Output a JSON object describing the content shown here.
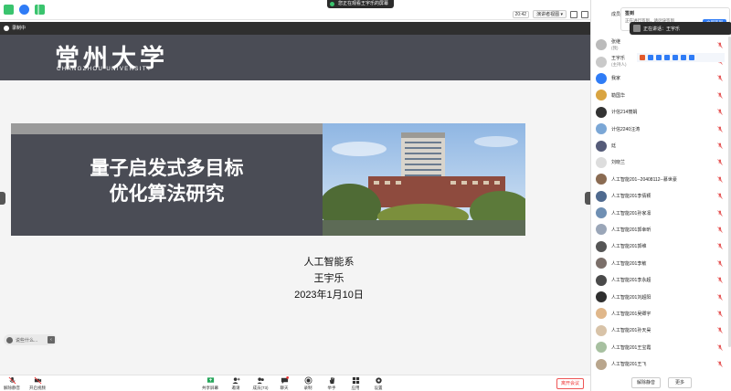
{
  "topbar": {
    "share_banner": "您正在观看王宇乐的屏幕",
    "time": "20:42",
    "view_label": "演讲者视图"
  },
  "recording": {
    "label": "录制中"
  },
  "slide": {
    "university_cn": "常州大学",
    "university_en": "CHANGZHOU UNIVERSITY",
    "title_line1": "量子启发式多目标",
    "title_line2": "优化算法研究",
    "department": "人工智能系",
    "author": "王宇乐",
    "date": "2023年1月10日"
  },
  "reaction_bar": {
    "placeholder": "说些什么..."
  },
  "toolbar": {
    "unmute": "解除静音",
    "start_video": "开启视频",
    "share_screen": "共享屏幕",
    "invite": "邀请",
    "members": "成员(73)",
    "chat": "聊天",
    "chat_badge": "1",
    "record": "录制",
    "raise_hand": "举手",
    "apps": "应用",
    "settings": "设置",
    "leave": "离开会议"
  },
  "panel": {
    "title": "成员(73)",
    "checkin_title": "签到",
    "checkin_sub": "正在进行签到，请尽快签到",
    "checkin_button": "立即签到",
    "speaking_label": "正在讲话：王宇乐",
    "participants": [
      {
        "name": "张继",
        "sub": "(我)",
        "color": "#bbbbbb"
      },
      {
        "name": "王宇乐",
        "sub": "(主持人)",
        "color": "#c9c9c9"
      },
      {
        "name": "我家",
        "sub": "",
        "color": "#2f7cf6"
      },
      {
        "name": "勒国华",
        "sub": "",
        "color": "#d9a441"
      },
      {
        "name": "计信214丽娟",
        "sub": "",
        "color": "#333333"
      },
      {
        "name": "计信2240汪涛",
        "sub": "",
        "color": "#7ba7d6"
      },
      {
        "name": "廷",
        "sub": "",
        "color": "#555b78"
      },
      {
        "name": "刘晓兰",
        "sub": "",
        "color": "#dddddd"
      },
      {
        "name": "人工智能201--20408112--慕世豪",
        "sub": "",
        "color": "#8a6b52"
      },
      {
        "name": "人工智能201李倩颖",
        "sub": "",
        "color": "#4f6a8f"
      },
      {
        "name": "人工智能201孙家凛",
        "sub": "",
        "color": "#6f8fb3"
      },
      {
        "name": "人工智能201郭幸昕",
        "sub": "",
        "color": "#9aa6b8"
      },
      {
        "name": "人工智能201郭维",
        "sub": "",
        "color": "#555555"
      },
      {
        "name": "人工智能201李敏",
        "sub": "",
        "color": "#7b6f6a"
      },
      {
        "name": "人工智能201李永超",
        "sub": "",
        "color": "#4a4a4a"
      },
      {
        "name": "人工智能201刘超阳",
        "sub": "",
        "color": "#2f2f2f"
      },
      {
        "name": "人工智能201吴卿宇",
        "sub": "",
        "color": "#e0b78a"
      },
      {
        "name": "人工智能201孙天昊",
        "sub": "",
        "color": "#d8c3a8"
      },
      {
        "name": "人工智能201王宝霞",
        "sub": "",
        "color": "#a7c0a0"
      },
      {
        "name": "人工智能201王飞",
        "sub": "",
        "color": "#b9a68d"
      }
    ],
    "unmute_all": "解除静音",
    "more": "更多"
  },
  "colors": {
    "slide_dark": "#4a4c55",
    "accent_blue": "#2f7cf6",
    "leave_red": "#e33333",
    "muted_mic_red": "#e55353"
  }
}
